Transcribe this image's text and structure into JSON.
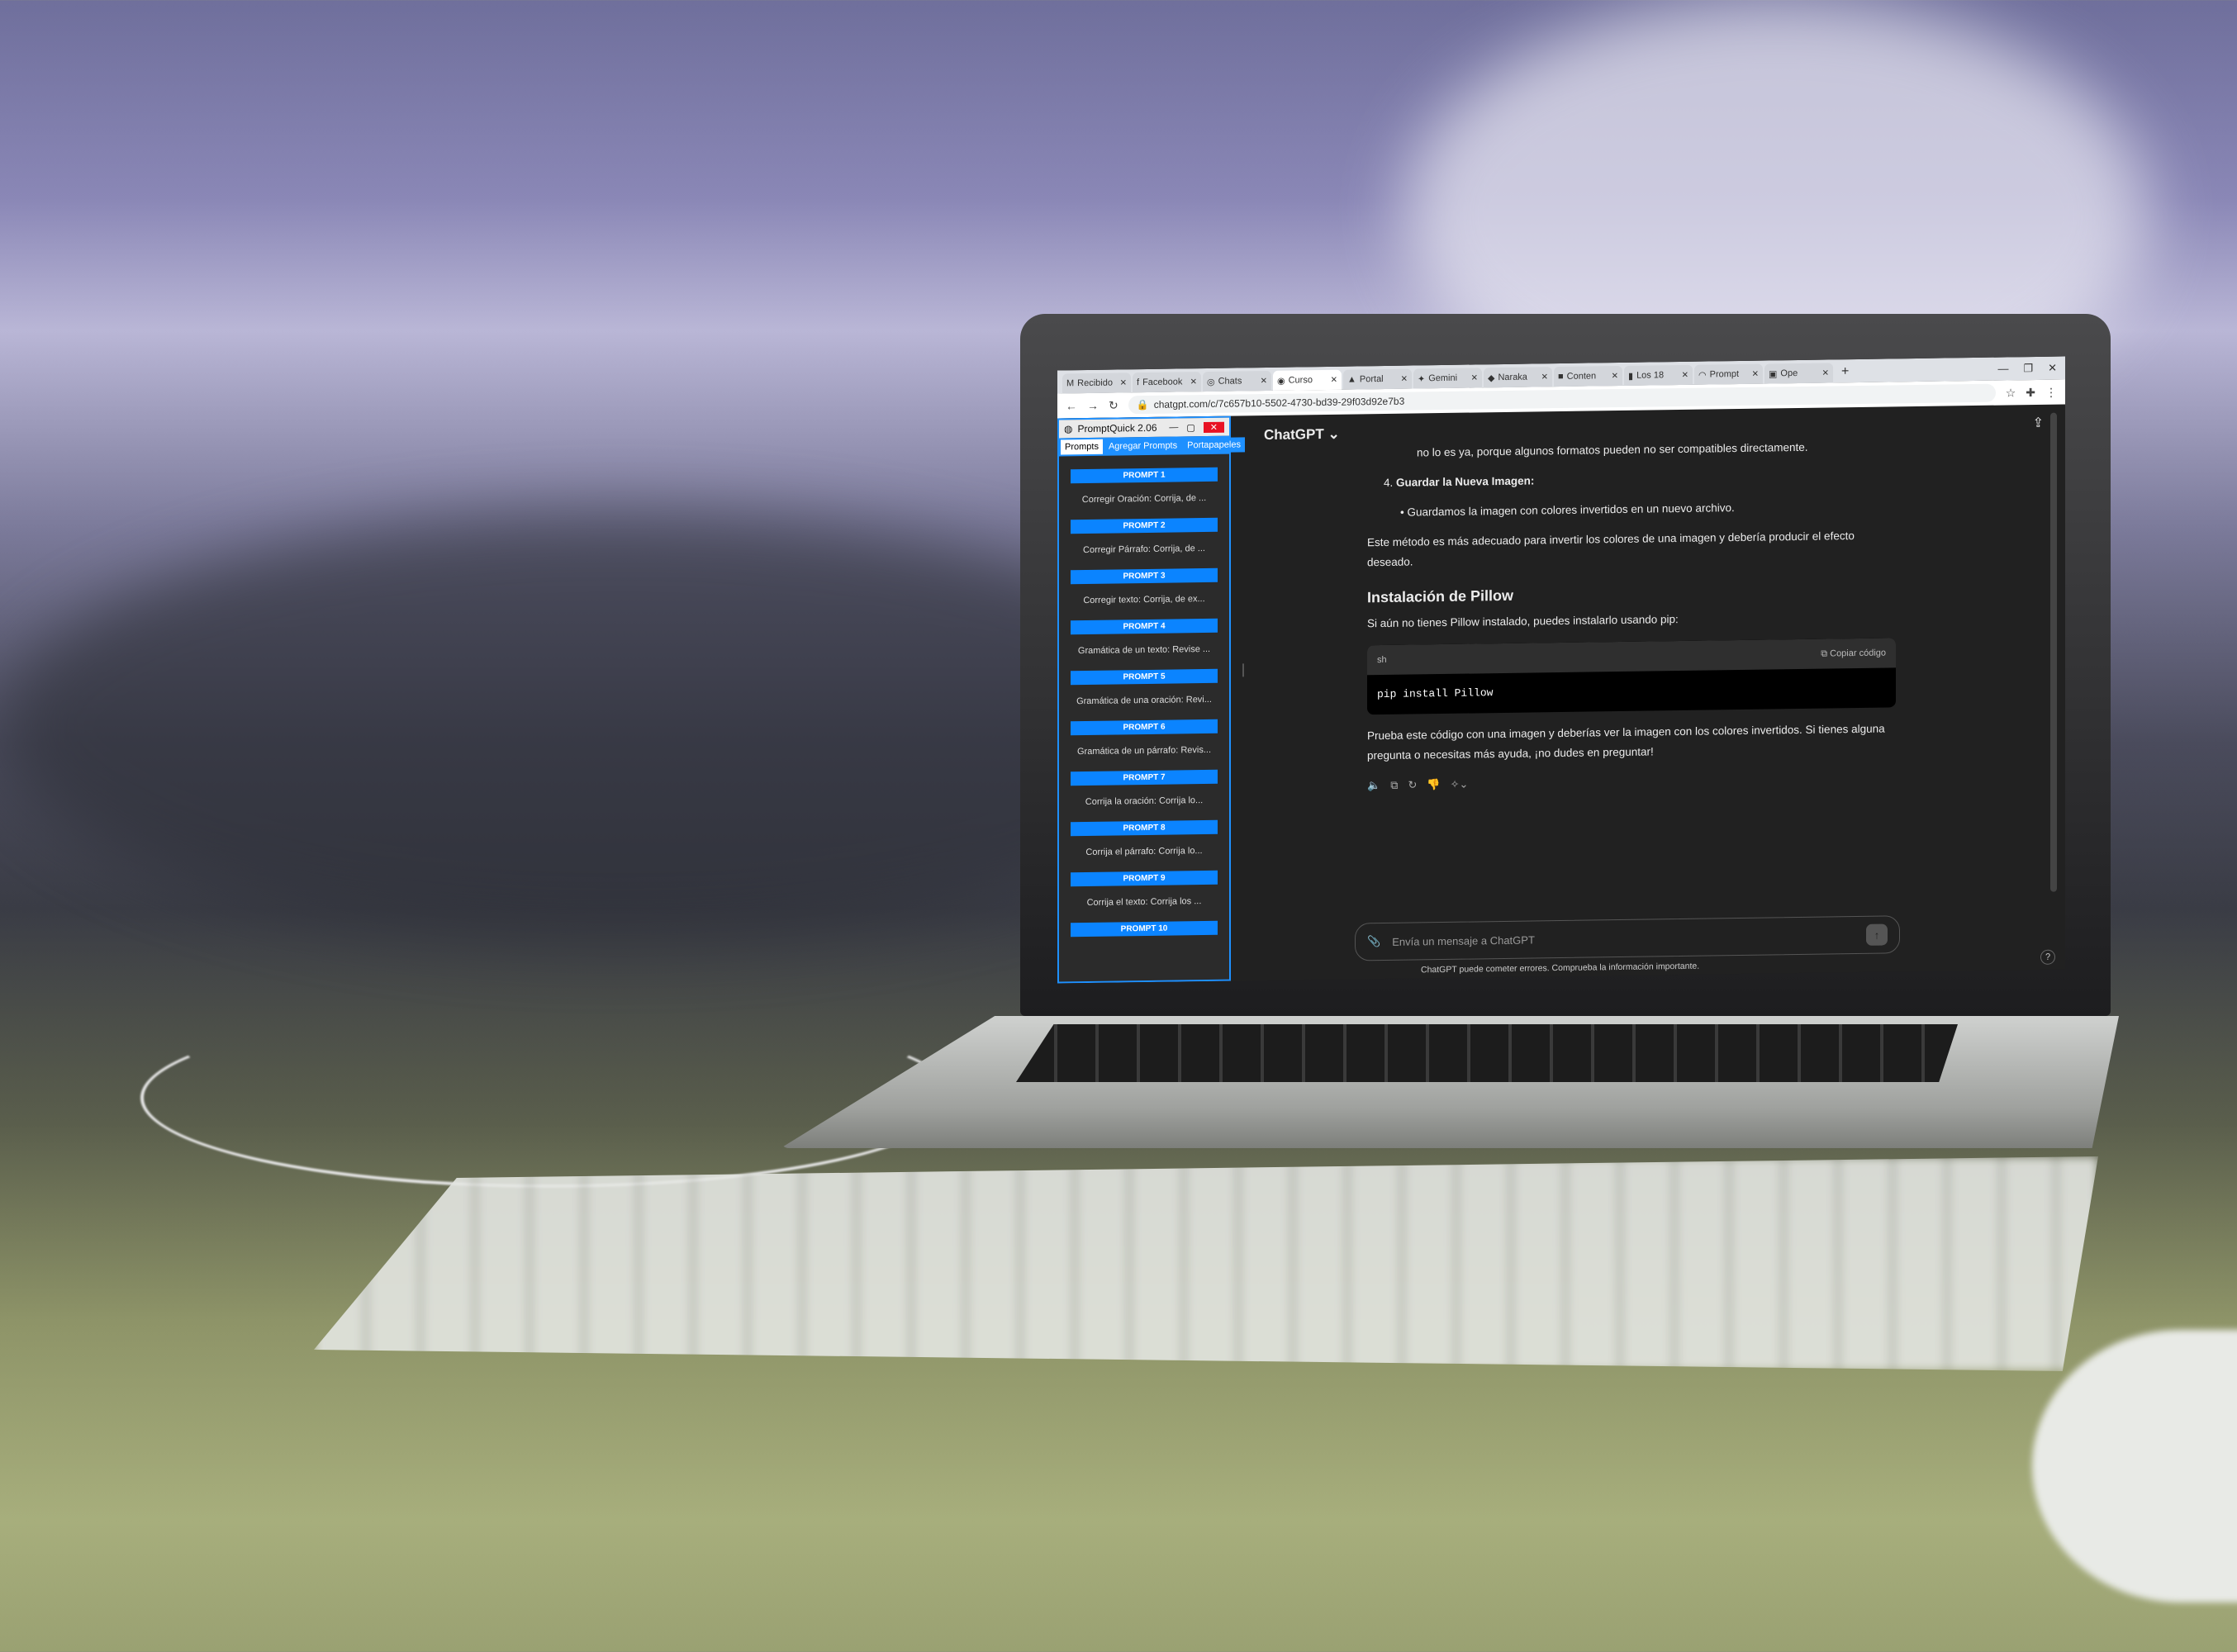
{
  "tabs": [
    {
      "icon": "M",
      "label": "Recibido"
    },
    {
      "icon": "f",
      "label": "Facebook"
    },
    {
      "icon": "◎",
      "label": "Chats"
    },
    {
      "icon": "◉",
      "label": "Curso"
    },
    {
      "icon": "▲",
      "label": "Portal"
    },
    {
      "icon": "✦",
      "label": "Gemini"
    },
    {
      "icon": "◆",
      "label": "Naraka"
    },
    {
      "icon": "■",
      "label": "Conten"
    },
    {
      "icon": "▮",
      "label": "Los 18"
    },
    {
      "icon": "◠",
      "label": "Prompt"
    },
    {
      "icon": "▣",
      "label": "Ope"
    }
  ],
  "address": {
    "url": "chatgpt.com/c/7c657b10-5502-4730-bd39-29f03d92e7b3"
  },
  "promptquick": {
    "title": "PromptQuick 2.06",
    "tabs": [
      "Prompts",
      "Agregar Prompts",
      "Portapapeles"
    ],
    "items": [
      {
        "head": "PROMPT 1",
        "text": "Corregir Oración: Corrija, de ..."
      },
      {
        "head": "PROMPT 2",
        "text": "Corregir Párrafo: Corrija, de ..."
      },
      {
        "head": "PROMPT 3",
        "text": "Corregir texto: Corrija, de ex..."
      },
      {
        "head": "PROMPT 4",
        "text": "Gramática de un texto: Revise ..."
      },
      {
        "head": "PROMPT 5",
        "text": "Gramática de una oración: Revi..."
      },
      {
        "head": "PROMPT 6",
        "text": "Gramática de un párrafo: Revis..."
      },
      {
        "head": "PROMPT 7",
        "text": "Corrija la oración: Corrija lo..."
      },
      {
        "head": "PROMPT 8",
        "text": "Corrija el párrafo: Corrija lo..."
      },
      {
        "head": "PROMPT 9",
        "text": "Corrija el texto: Corrija los ..."
      },
      {
        "head": "PROMPT 10",
        "text": ""
      }
    ]
  },
  "chat": {
    "model": "ChatGPT",
    "line1": "no lo es ya, porque algunos formatos pueden no ser compatibles directamente.",
    "step_number": "4.",
    "step_title": "Guardar la Nueva Imagen:",
    "bullet": "Guardamos la imagen con colores invertidos en un nuevo archivo.",
    "para1": "Este método es más adecuado para invertir los colores de una imagen y debería producir el efecto deseado.",
    "heading": "Instalación de Pillow",
    "para2": "Si aún no tienes Pillow instalado, puedes instalarlo usando pip:",
    "code_lang": "sh",
    "code_copy": "Copiar código",
    "code": "pip install Pillow",
    "para3": "Prueba este código con una imagen y deberías ver la imagen con los colores invertidos. Si tienes alguna pregunta o necesitas más ayuda, ¡no dudes en preguntar!",
    "input_placeholder": "Envía un mensaje a ChatGPT",
    "footer": "ChatGPT puede cometer errores. Comprueba la información importante.",
    "help": "?"
  }
}
